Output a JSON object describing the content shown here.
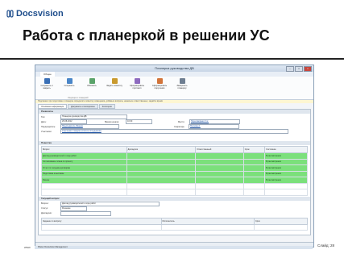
{
  "slide": {
    "logo_text": "Docsvision",
    "title": "Работа с планеркой в решении УС",
    "footer_left": "www.",
    "slide_number": "Слайд: 28"
  },
  "window": {
    "title": "Планерка руководства ДВ",
    "controls": [
      "–",
      "□",
      "×"
    ],
    "ribbon_tab": "Общее",
    "ribbon_buttons": [
      {
        "label": "Сохранить и закрыть",
        "icon": "save-close-icon",
        "color": "#3a6fb5"
      },
      {
        "label": "Сохранить",
        "icon": "save-icon",
        "color": "#4a86c8"
      },
      {
        "label": "Обновить",
        "icon": "refresh-icon",
        "color": "#5aa36a"
      },
      {
        "label": "Задать повестку",
        "icon": "agenda-icon",
        "color": "#c99a2e"
      },
      {
        "label": "Сформировать протокол",
        "icon": "protocol-icon",
        "color": "#8e6bbf"
      },
      {
        "label": "Сформировать поручения",
        "icon": "tasks-icon",
        "color": "#d2743a"
      },
      {
        "label": "Завершить планерку",
        "icon": "finish-icon",
        "color": "#6e7e91"
      }
    ],
    "ribbon_group": "Операции с планеркой",
    "info_text": "Подсказка: при подготовке к планерке определите повестку совещания, добавьте вопросы, назначьте ответственных, задайте время",
    "tabs": [
      "Основная информация",
      "Документы и материалы",
      "Категории"
    ],
    "sections": {
      "props_title": "Реквизиты",
      "agenda_title": "Повестка",
      "task_title": "Текущий вопрос"
    },
    "fields": {
      "type_label": "Тип:",
      "type_value": "Планерка руководства ДВ",
      "date_label": "Дата:",
      "date_value": "29.08.2012",
      "time_start_label": "Время начала:",
      "time_start_value": "10:00",
      "place_label": "Место:",
      "place_value": "Переговорная 3 эт.",
      "chair_label": "Председатель:",
      "chair_value": "Председатель Иванов",
      "secretary_label": "Секретарь:",
      "secretary_value": "Петрова А.",
      "participants_label": "Участники:",
      "participants_value": "Участники планерки (список сотрудников)"
    },
    "grid": {
      "headers": [
        "Вопрос",
        "Докладчик",
        "Ответственный",
        "Срок",
        "Состояние"
      ],
      "rows": [
        {
          "q": "Доклад руководителей о ходе работ",
          "d": "",
          "r": "",
          "t": "",
          "s": "В рассмотрении"
        },
        {
          "q": "Согласование плана по проекту",
          "d": "",
          "r": "",
          "t": "",
          "s": "В рассмотрении"
        },
        {
          "q": "Отчет по текущим договорам",
          "d": "",
          "r": "",
          "t": "",
          "s": "В рассмотрении"
        },
        {
          "q": "Подготовка к выставке",
          "d": "",
          "r": "",
          "t": "",
          "s": "В рассмотрении"
        },
        {
          "q": "Разное",
          "d": "",
          "r": "",
          "t": "",
          "s": "В рассмотрении"
        }
      ]
    },
    "task": {
      "question_label": "Вопрос:",
      "question_value": "Доклад руководителей о ходе работ",
      "status_label": "Статус:",
      "status_value": "Решение",
      "report_label": "Докладчик:",
      "report_value": "",
      "sub_headers": [
        "Задание по вопросу",
        "Исполнитель",
        "Срок"
      ]
    },
    "taskbar_text": "Planer Docsvision Management"
  }
}
